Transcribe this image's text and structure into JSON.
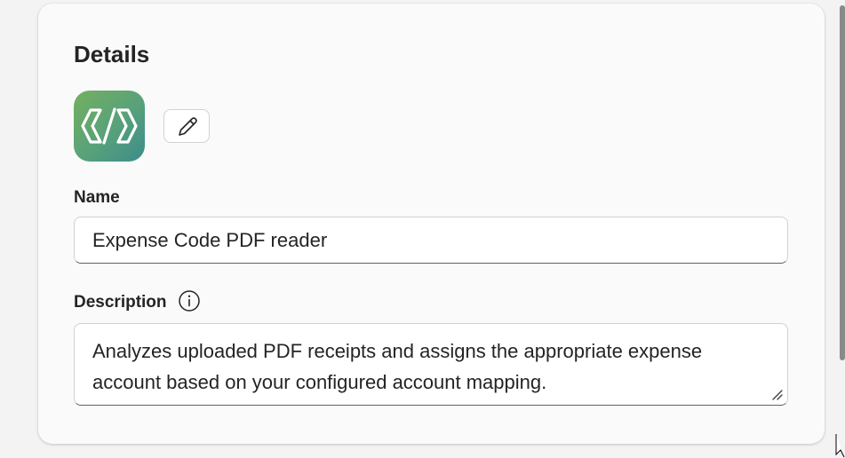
{
  "details": {
    "title": "Details",
    "icons": {
      "app_icon": "code-brackets-icon",
      "edit": "pencil-icon",
      "info": "info-icon",
      "resize": "resize-grip-icon"
    },
    "colors": {
      "app_icon_gradient_start": "#74b060",
      "app_icon_gradient_end": "#3c8c8c"
    },
    "name": {
      "label": "Name",
      "value": "Expense Code PDF reader"
    },
    "description": {
      "label": "Description",
      "value": "Analyzes uploaded PDF receipts and assigns the appropriate expense account based on your configured account mapping."
    }
  }
}
